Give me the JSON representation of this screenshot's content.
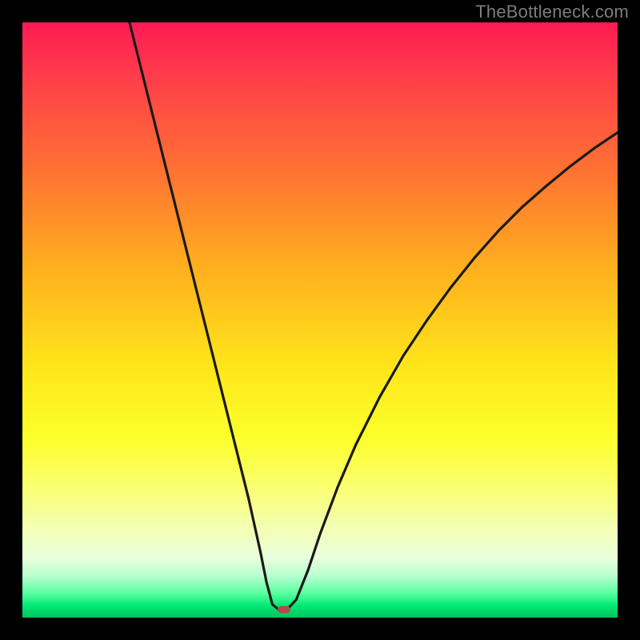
{
  "watermark": "TheBottleneck.com",
  "colors": {
    "frame_bg": "#000000",
    "watermark": "#7d7d7d",
    "curve_stroke": "#1a1a1a",
    "marker_fill": "#b54a4a",
    "gradient_stops": [
      "#ff1a53",
      "#ff3a4c",
      "#ff7232",
      "#ffb21e",
      "#ffe61a",
      "#fdff2c",
      "#faff6f",
      "#f4ffb4",
      "#e8ffdc",
      "#b8ffd0",
      "#55ff9e",
      "#00e874",
      "#00c45e"
    ]
  },
  "chart_data": {
    "type": "line",
    "title": "",
    "xlabel": "",
    "ylabel": "",
    "xlim": [
      0,
      100
    ],
    "ylim": [
      0,
      100
    ],
    "grid": false,
    "legend": false,
    "series": [
      {
        "name": "bottleneck-curve",
        "x": [
          18,
          20,
          22,
          24,
          26,
          28,
          30,
          32,
          34,
          36,
          38,
          40,
          41,
          42,
          43,
          44.5,
          46,
          48,
          50,
          53,
          56,
          60,
          64,
          68,
          72,
          76,
          80,
          84,
          88,
          92,
          96,
          100
        ],
        "y": [
          100,
          92,
          84,
          76,
          68,
          60,
          52,
          44,
          36,
          28,
          20,
          11,
          6,
          2.2,
          1.4,
          1.4,
          3,
          8,
          14,
          22,
          29,
          37,
          44,
          50,
          55.5,
          60.5,
          65,
          69,
          72.5,
          75.8,
          78.8,
          81.5
        ]
      }
    ],
    "marker": {
      "x": 44,
      "y": 1.3,
      "label": "optimal-point"
    },
    "background": "vertical-gradient (red→orange→yellow→green) representing bottleneck severity; curve shows bottleneck % vs. component balance, minimum at ~44%"
  }
}
